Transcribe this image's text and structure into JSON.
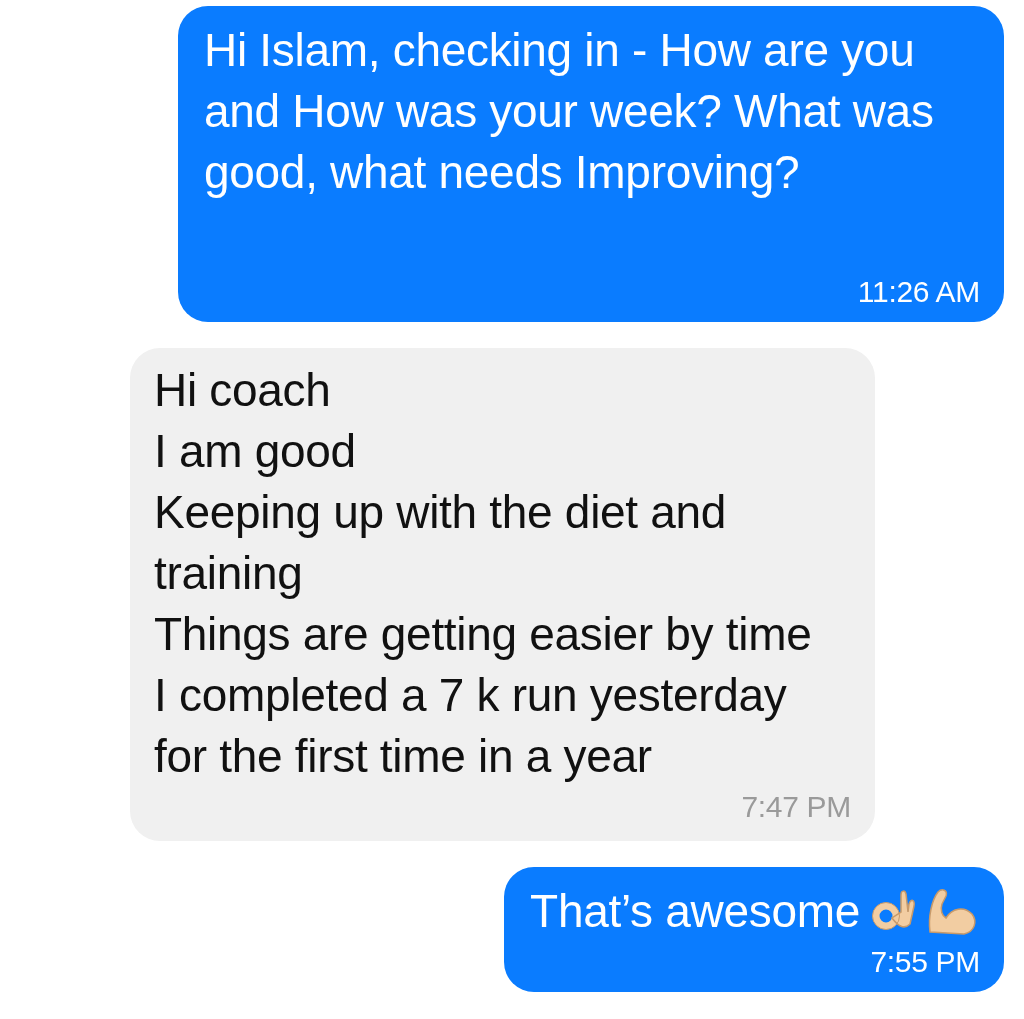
{
  "messages": [
    {
      "kind": "sent",
      "lines": [
        "Hi Islam, checking in - How are you and How was your week? What was good, what needs Improving?"
      ],
      "time": "11:26 AM"
    },
    {
      "kind": "received",
      "lines": [
        "Hi coach",
        "I am good",
        "Keeping up with the diet and training",
        "Things are getting easier by time",
        "I completed a 7 k run yesterday",
        "for the first time in a year"
      ],
      "time": "7:47 PM"
    },
    {
      "kind": "sent-emoji",
      "lines": [
        "That’s awesome"
      ],
      "time": "7:55 PM"
    }
  ]
}
